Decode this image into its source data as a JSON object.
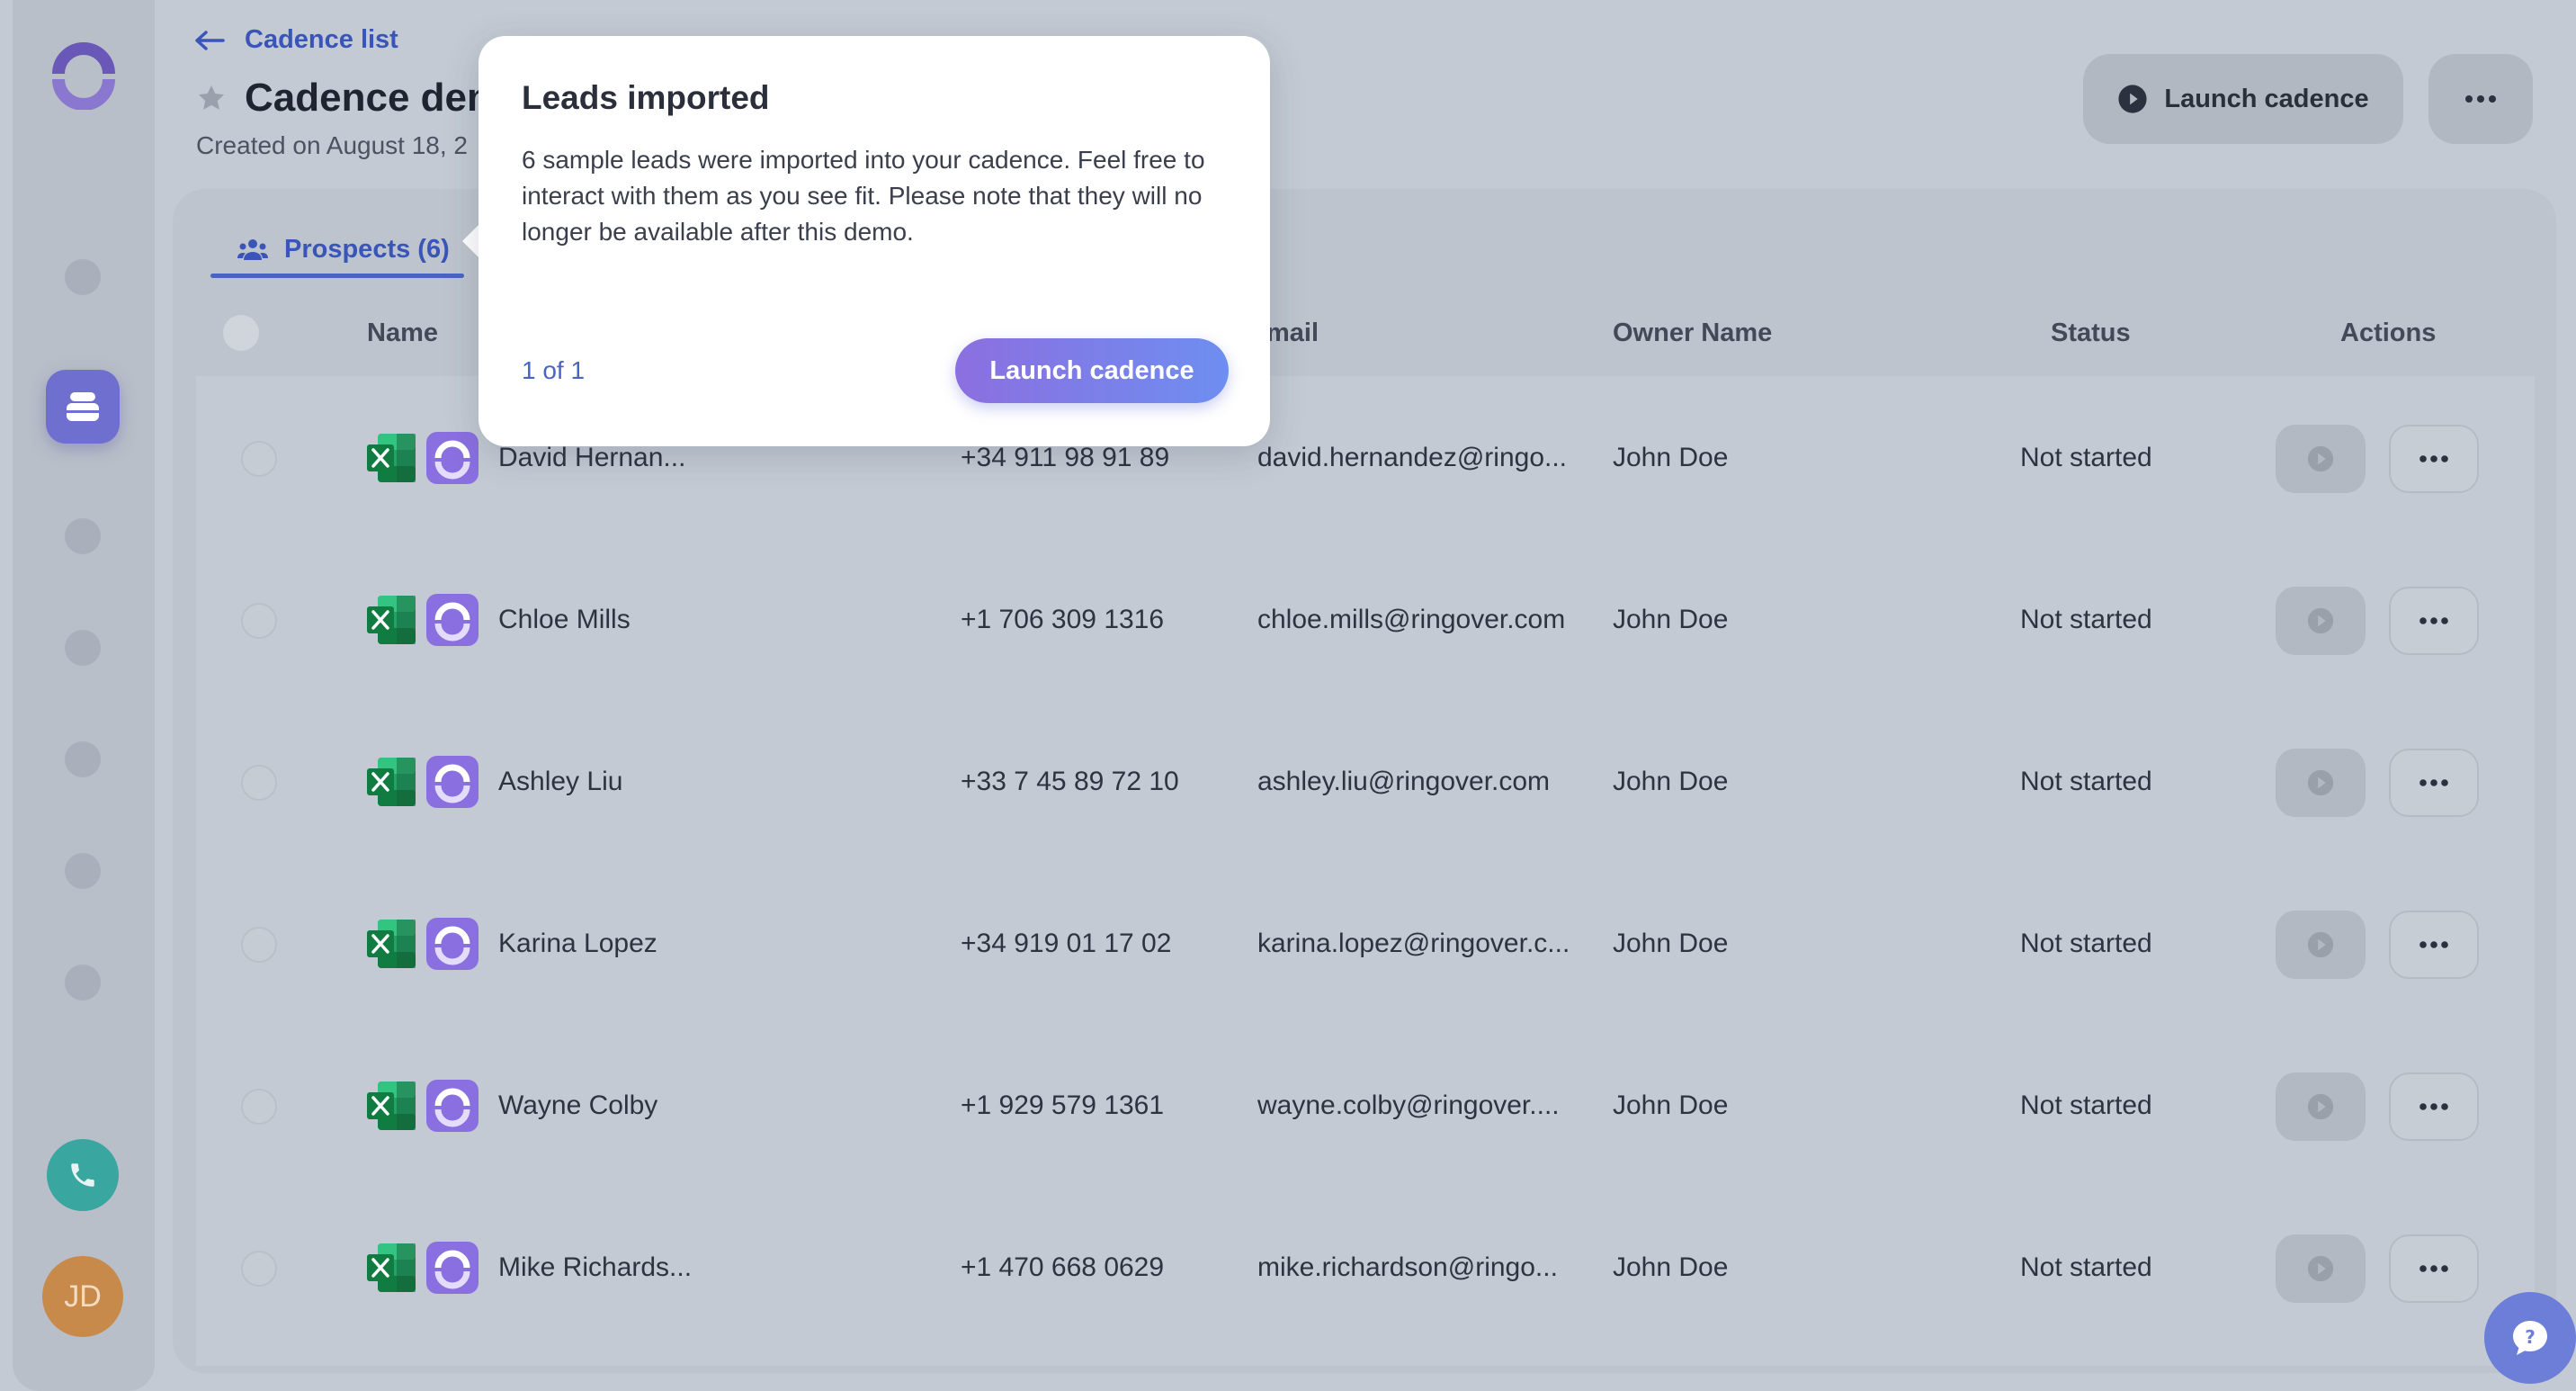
{
  "nav": {
    "back_label": "Cadence list"
  },
  "header": {
    "title": "Cadence dem",
    "created": "Created on August 18, 2",
    "launch_label": "Launch cadence"
  },
  "tabs": [
    {
      "label": "Prospects (6)"
    }
  ],
  "table": {
    "columns": [
      "Name",
      "mail",
      "Owner Name",
      "Status",
      "Actions"
    ],
    "rows": [
      {
        "name": "David Hernan...",
        "phone": "+34 911 98 91 89",
        "email": "david.hernandez@ringo...",
        "owner": "John Doe",
        "status": "Not started"
      },
      {
        "name": "Chloe Mills",
        "phone": "+1 706 309 1316",
        "email": "chloe.mills@ringover.com",
        "owner": "John Doe",
        "status": "Not started"
      },
      {
        "name": "Ashley Liu",
        "phone": "+33 7 45 89 72 10",
        "email": "ashley.liu@ringover.com",
        "owner": "John Doe",
        "status": "Not started"
      },
      {
        "name": "Karina Lopez",
        "phone": "+34 919 01 17 02",
        "email": "karina.lopez@ringover.c...",
        "owner": "John Doe",
        "status": "Not started"
      },
      {
        "name": "Wayne Colby",
        "phone": "+1 929 579 1361",
        "email": "wayne.colby@ringover....",
        "owner": "John Doe",
        "status": "Not started"
      },
      {
        "name": "Mike Richards...",
        "phone": "+1 470 668 0629",
        "email": "mike.richardson@ringo...",
        "owner": "John Doe",
        "status": "Not started"
      }
    ]
  },
  "popover": {
    "title": "Leads imported",
    "body": "6 sample leads were imported into your cadence. Feel free to interact with them as you see fit. Please note that they will no longer be available after this demo.",
    "step": "1 of 1",
    "button_label": "Launch cadence"
  },
  "user": {
    "initials": "JD"
  },
  "colors": {
    "accent": "#4a64c4",
    "brand_purple": "#8b6fe0",
    "excel_green": "#1e7145",
    "phone_teal": "#3aa6a0",
    "avatar_orange": "#c88a4b"
  }
}
